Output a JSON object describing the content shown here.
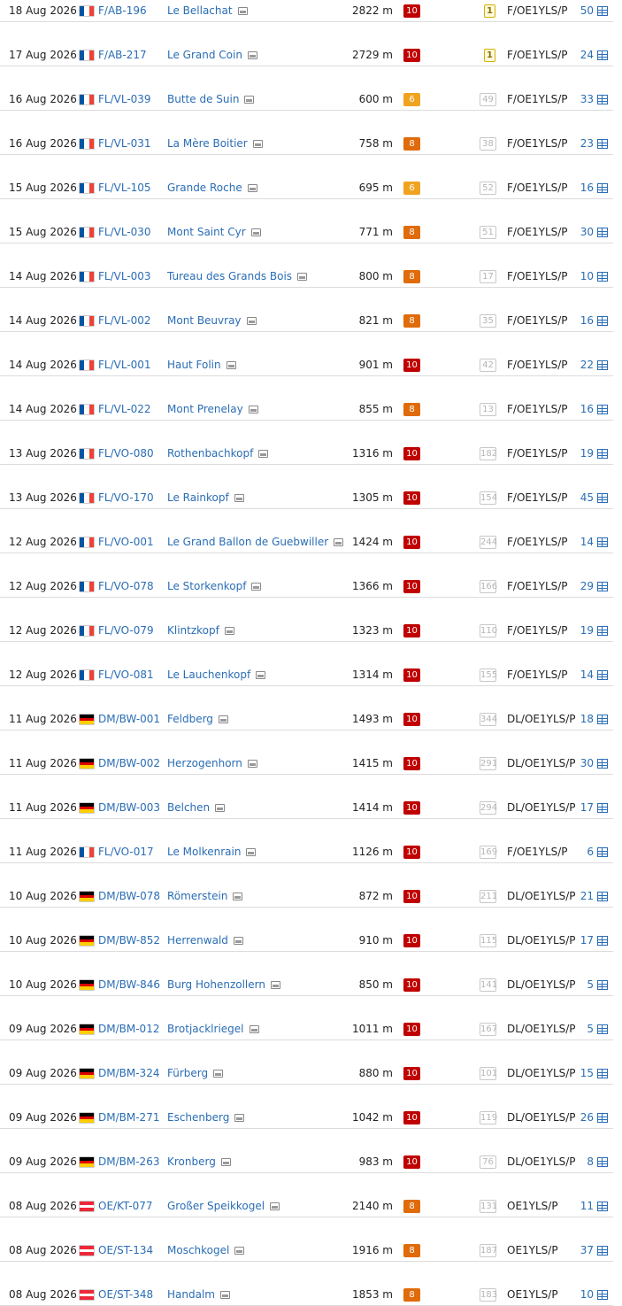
{
  "colors": {
    "link": "#2a6db5",
    "points_10": "#c00000",
    "points_8": "#e06b0a",
    "points_6": "#f0a320",
    "first_badge": "#d4b000"
  },
  "flags": {
    "fr": [
      "#0055A4",
      "#FFFFFF",
      "#EF4135"
    ],
    "de": [
      "#000000",
      "#DD0000",
      "#FFCE00"
    ],
    "at": [
      "#ED2939",
      "#FFFFFF",
      "#ED2939"
    ]
  },
  "rows": [
    {
      "date": "18 Aug 2026",
      "country": "fr",
      "ref": "F/AB-196",
      "name": "Le Bellachat",
      "alt": "2822 m",
      "points": "10",
      "activations": "1",
      "first": true,
      "callsign": "F/OE1YLS/P",
      "count": "50"
    },
    {
      "date": "17 Aug 2026",
      "country": "fr",
      "ref": "F/AB-217",
      "name": "Le Grand Coin",
      "alt": "2729 m",
      "points": "10",
      "activations": "1",
      "first": true,
      "callsign": "F/OE1YLS/P",
      "count": "24"
    },
    {
      "date": "16 Aug 2026",
      "country": "fr",
      "ref": "FL/VL-039",
      "name": "Butte de Suin",
      "alt": "600 m",
      "points": "6",
      "activations": "49",
      "first": false,
      "callsign": "F/OE1YLS/P",
      "count": "33"
    },
    {
      "date": "16 Aug 2026",
      "country": "fr",
      "ref": "FL/VL-031",
      "name": "La Mère Boitier",
      "alt": "758 m",
      "points": "8",
      "activations": "38",
      "first": false,
      "callsign": "F/OE1YLS/P",
      "count": "23"
    },
    {
      "date": "15 Aug 2026",
      "country": "fr",
      "ref": "FL/VL-105",
      "name": "Grande Roche",
      "alt": "695 m",
      "points": "6",
      "activations": "52",
      "first": false,
      "callsign": "F/OE1YLS/P",
      "count": "16"
    },
    {
      "date": "15 Aug 2026",
      "country": "fr",
      "ref": "FL/VL-030",
      "name": "Mont Saint Cyr",
      "alt": "771 m",
      "points": "8",
      "activations": "51",
      "first": false,
      "callsign": "F/OE1YLS/P",
      "count": "30"
    },
    {
      "date": "14 Aug 2026",
      "country": "fr",
      "ref": "FL/VL-003",
      "name": "Tureau des Grands Bois",
      "alt": "800 m",
      "points": "8",
      "activations": "17",
      "first": false,
      "callsign": "F/OE1YLS/P",
      "count": "10"
    },
    {
      "date": "14 Aug 2026",
      "country": "fr",
      "ref": "FL/VL-002",
      "name": "Mont Beuvray",
      "alt": "821 m",
      "points": "8",
      "activations": "35",
      "first": false,
      "callsign": "F/OE1YLS/P",
      "count": "16"
    },
    {
      "date": "14 Aug 2026",
      "country": "fr",
      "ref": "FL/VL-001",
      "name": "Haut Folin",
      "alt": "901 m",
      "points": "10",
      "activations": "42",
      "first": false,
      "callsign": "F/OE1YLS/P",
      "count": "22"
    },
    {
      "date": "14 Aug 2026",
      "country": "fr",
      "ref": "FL/VL-022",
      "name": "Mont Prenelay",
      "alt": "855 m",
      "points": "8",
      "activations": "13",
      "first": false,
      "callsign": "F/OE1YLS/P",
      "count": "16"
    },
    {
      "date": "13 Aug 2026",
      "country": "fr",
      "ref": "FL/VO-080",
      "name": "Rothenbachkopf",
      "alt": "1316 m",
      "points": "10",
      "activations": "182",
      "first": false,
      "callsign": "F/OE1YLS/P",
      "count": "19"
    },
    {
      "date": "13 Aug 2026",
      "country": "fr",
      "ref": "FL/VO-170",
      "name": "Le Rainkopf",
      "alt": "1305 m",
      "points": "10",
      "activations": "154",
      "first": false,
      "callsign": "F/OE1YLS/P",
      "count": "45"
    },
    {
      "date": "12 Aug 2026",
      "country": "fr",
      "ref": "FL/VO-001",
      "name": "Le Grand Ballon de Guebwiller",
      "alt": "1424 m",
      "points": "10",
      "activations": "244",
      "first": false,
      "callsign": "F/OE1YLS/P",
      "count": "14"
    },
    {
      "date": "12 Aug 2026",
      "country": "fr",
      "ref": "FL/VO-078",
      "name": "Le Storkenkopf",
      "alt": "1366 m",
      "points": "10",
      "activations": "166",
      "first": false,
      "callsign": "F/OE1YLS/P",
      "count": "29"
    },
    {
      "date": "12 Aug 2026",
      "country": "fr",
      "ref": "FL/VO-079",
      "name": "Klintzkopf",
      "alt": "1323 m",
      "points": "10",
      "activations": "110",
      "first": false,
      "callsign": "F/OE1YLS/P",
      "count": "19"
    },
    {
      "date": "12 Aug 2026",
      "country": "fr",
      "ref": "FL/VO-081",
      "name": "Le Lauchenkopf",
      "alt": "1314 m",
      "points": "10",
      "activations": "155",
      "first": false,
      "callsign": "F/OE1YLS/P",
      "count": "14"
    },
    {
      "date": "11 Aug 2026",
      "country": "de",
      "ref": "DM/BW-001",
      "name": "Feldberg",
      "alt": "1493 m",
      "points": "10",
      "activations": "344",
      "first": false,
      "callsign": "DL/OE1YLS/P",
      "count": "18"
    },
    {
      "date": "11 Aug 2026",
      "country": "de",
      "ref": "DM/BW-002",
      "name": "Herzogenhorn",
      "alt": "1415 m",
      "points": "10",
      "activations": "291",
      "first": false,
      "callsign": "DL/OE1YLS/P",
      "count": "30"
    },
    {
      "date": "11 Aug 2026",
      "country": "de",
      "ref": "DM/BW-003",
      "name": "Belchen",
      "alt": "1414 m",
      "points": "10",
      "activations": "294",
      "first": false,
      "callsign": "DL/OE1YLS/P",
      "count": "17"
    },
    {
      "date": "11 Aug 2026",
      "country": "fr",
      "ref": "FL/VO-017",
      "name": "Le Molkenrain",
      "alt": "1126 m",
      "points": "10",
      "activations": "169",
      "first": false,
      "callsign": "F/OE1YLS/P",
      "count": "6"
    },
    {
      "date": "10 Aug 2026",
      "country": "de",
      "ref": "DM/BW-078",
      "name": "Römerstein",
      "alt": "872 m",
      "points": "10",
      "activations": "211",
      "first": false,
      "callsign": "DL/OE1YLS/P",
      "count": "21"
    },
    {
      "date": "10 Aug 2026",
      "country": "de",
      "ref": "DM/BW-852",
      "name": "Herrenwald",
      "alt": "910 m",
      "points": "10",
      "activations": "115",
      "first": false,
      "callsign": "DL/OE1YLS/P",
      "count": "17"
    },
    {
      "date": "10 Aug 2026",
      "country": "de",
      "ref": "DM/BW-846",
      "name": "Burg Hohenzollern",
      "alt": "850 m",
      "points": "10",
      "activations": "141",
      "first": false,
      "callsign": "DL/OE1YLS/P",
      "count": "5"
    },
    {
      "date": "09 Aug 2026",
      "country": "de",
      "ref": "DM/BM-012",
      "name": "Brotjacklriegel",
      "alt": "1011 m",
      "points": "10",
      "activations": "167",
      "first": false,
      "callsign": "DL/OE1YLS/P",
      "count": "5"
    },
    {
      "date": "09 Aug 2026",
      "country": "de",
      "ref": "DM/BM-324",
      "name": "Fürberg",
      "alt": "880 m",
      "points": "10",
      "activations": "101",
      "first": false,
      "callsign": "DL/OE1YLS/P",
      "count": "15"
    },
    {
      "date": "09 Aug 2026",
      "country": "de",
      "ref": "DM/BM-271",
      "name": "Eschenberg",
      "alt": "1042 m",
      "points": "10",
      "activations": "119",
      "first": false,
      "callsign": "DL/OE1YLS/P",
      "count": "26"
    },
    {
      "date": "09 Aug 2026",
      "country": "de",
      "ref": "DM/BM-263",
      "name": "Kronberg",
      "alt": "983 m",
      "points": "10",
      "activations": "76",
      "first": false,
      "callsign": "DL/OE1YLS/P",
      "count": "8"
    },
    {
      "date": "08 Aug 2026",
      "country": "at",
      "ref": "OE/KT-077",
      "name": "Großer Speikkogel",
      "alt": "2140 m",
      "points": "8",
      "activations": "131",
      "first": false,
      "callsign": "OE1YLS/P",
      "count": "11"
    },
    {
      "date": "08 Aug 2026",
      "country": "at",
      "ref": "OE/ST-134",
      "name": "Moschkogel",
      "alt": "1916 m",
      "points": "8",
      "activations": "187",
      "first": false,
      "callsign": "OE1YLS/P",
      "count": "37"
    },
    {
      "date": "08 Aug 2026",
      "country": "at",
      "ref": "OE/ST-348",
      "name": "Handalm",
      "alt": "1853 m",
      "points": "8",
      "activations": "183",
      "first": false,
      "callsign": "OE1YLS/P",
      "count": "10"
    }
  ]
}
